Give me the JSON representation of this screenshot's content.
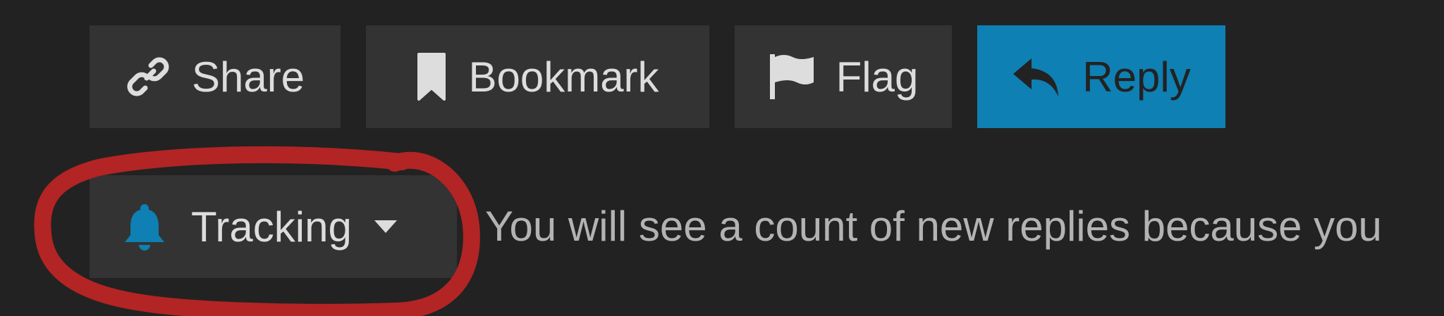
{
  "actions": {
    "share_label": "Share",
    "bookmark_label": "Bookmark",
    "flag_label": "Flag",
    "reply_label": "Reply"
  },
  "notifications": {
    "level_label": "Tracking",
    "description": "You will see a count of new replies because you"
  },
  "icons": {
    "share": "link-icon",
    "bookmark": "bookmark-icon",
    "flag": "flag-icon",
    "reply": "reply-icon",
    "tracking": "bell-icon",
    "dropdown": "caret-down-icon"
  },
  "colors": {
    "background": "#222222",
    "button_bg": "#333333",
    "button_text": "#dddddd",
    "reply_bg": "#0e80b3",
    "reply_text": "#222222",
    "bell": "#0e80b3",
    "description_text": "#b3b3b3",
    "annotation": "#b32424"
  }
}
